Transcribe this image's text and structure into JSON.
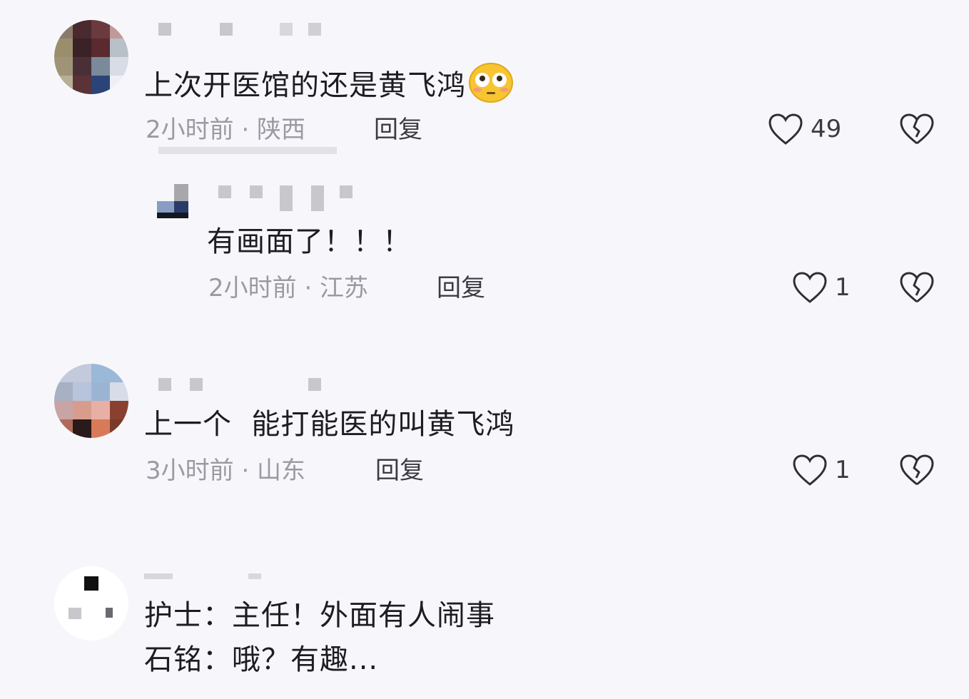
{
  "comments": [
    {
      "text": "上次开医馆的还是黄飞鸿",
      "meta": "2小时前 · 陕西",
      "reply_label": "回复",
      "likes": "49",
      "emoji": "flushed-face-emoji"
    },
    {
      "text": "有画面了！！！",
      "meta": "2小时前 · 江苏",
      "reply_label": "回复",
      "likes": "1"
    },
    {
      "text": "上一个  能打能医的叫黄飞鸿",
      "meta": "3小时前 · 山东",
      "reply_label": "回复",
      "likes": "1"
    },
    {
      "line1": "护士：主任！外面有人闹事",
      "line2": "石铭：哦？有趣..."
    }
  ],
  "icons": {
    "like": "heart-outline-icon",
    "dislike": "broken-heart-icon"
  },
  "colors": {
    "background": "#f7f7fb",
    "meta": "#9a9aa3",
    "text": "#1c1c22"
  }
}
